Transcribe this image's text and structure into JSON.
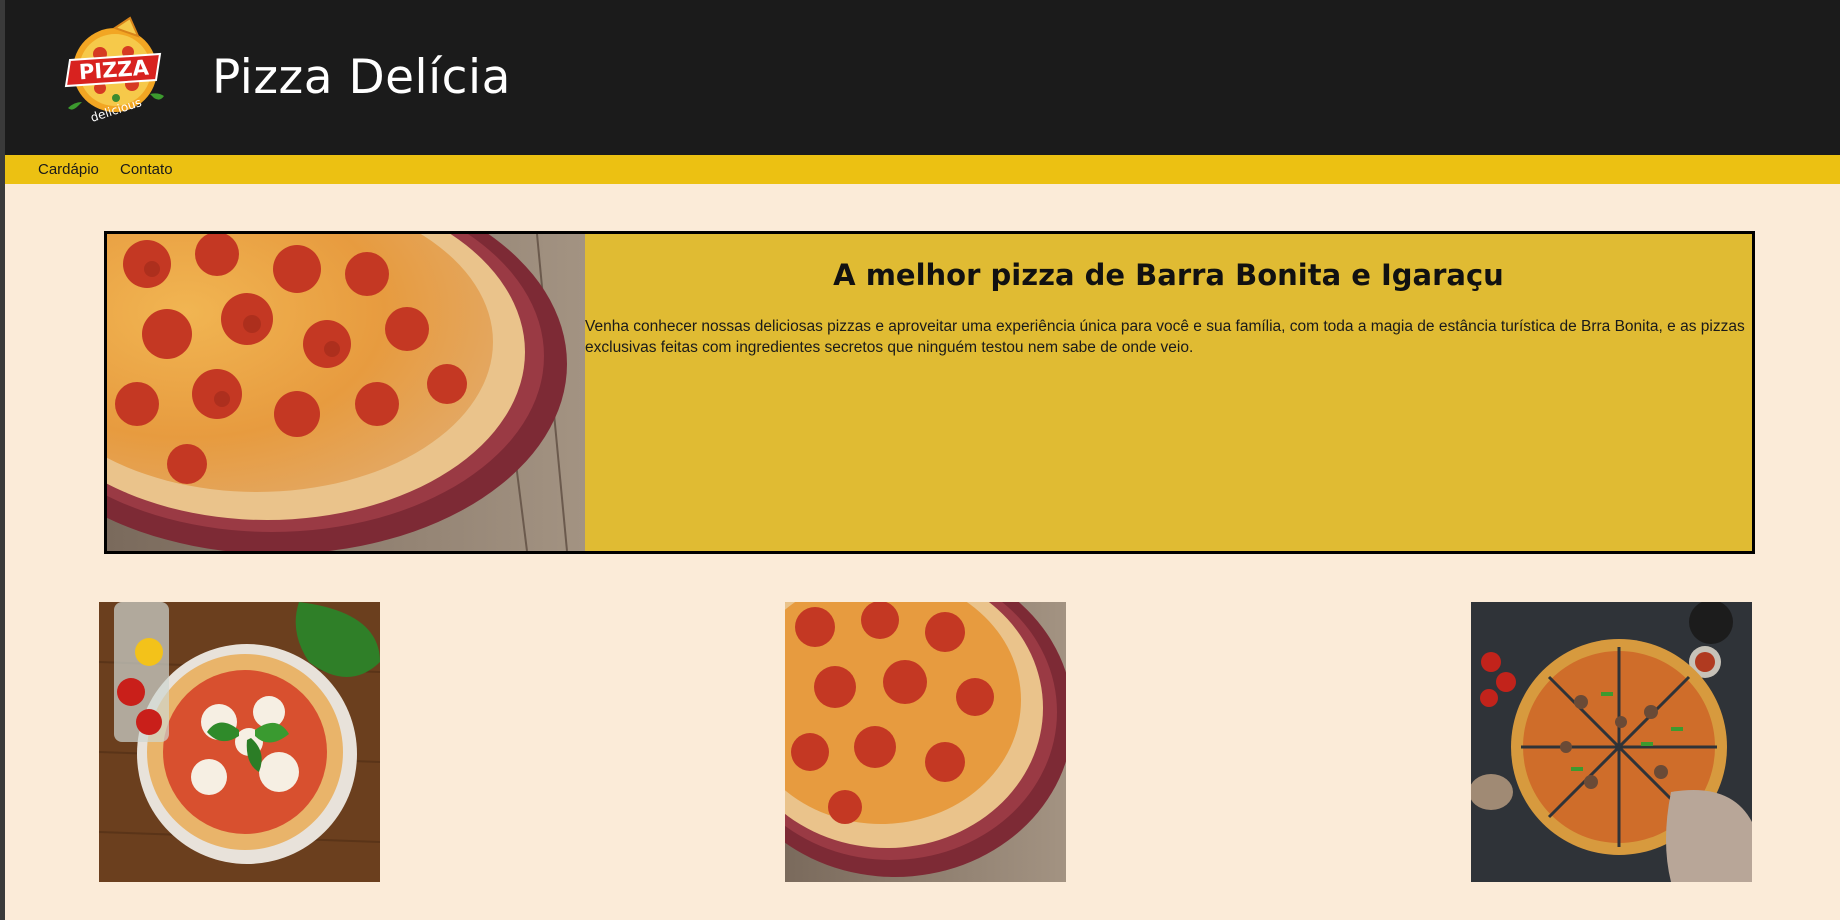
{
  "header": {
    "logo_alt": "PIZZA delicious",
    "logo_text_top": "PIZZA",
    "logo_text_bottom": "delicious",
    "title": "Pizza Delícia"
  },
  "nav": {
    "items": [
      {
        "label": "Cardápio"
      },
      {
        "label": "Contato"
      }
    ]
  },
  "hero": {
    "image": "pepperoni-pizza-photo",
    "title": "A melhor pizza de Barra Bonita e Igaraçu",
    "text": "Venha conhecer nossas deliciosas pizzas e aproveitar uma experiência única para você e sua família, com toda a magia de estância turística de Brra Bonita, e as pizzas exclusivas feitas com ingredientes secretos que ninguém testou nem sabe de onde veio."
  },
  "gallery": [
    {
      "image": "margherita-pizza-photo"
    },
    {
      "image": "pepperoni-pizza-photo"
    },
    {
      "image": "supreme-pizza-photo"
    }
  ],
  "colors": {
    "header_bg": "#1b1b1b",
    "nav_bg": "#ecc112",
    "page_bg": "#fbebd8",
    "hero_bg": "#e0bb33"
  }
}
